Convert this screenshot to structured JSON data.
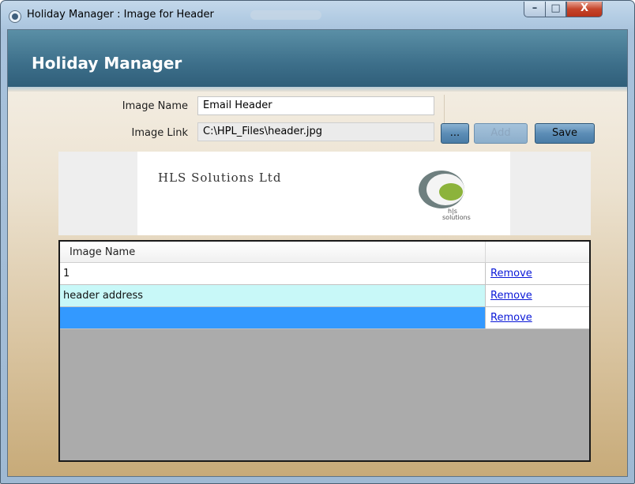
{
  "window": {
    "title": "Holiday Manager : Image for Header",
    "minimize_glyph": "–",
    "maximize_glyph": "□",
    "close_glyph": "X"
  },
  "banner": {
    "title": "Holiday Manager"
  },
  "form": {
    "image_name_label": "Image Name",
    "image_name_value": "Email Header",
    "image_link_label": "Image Link",
    "image_link_value": "C:\\HPL_Files\\header.jpg",
    "browse_label": "...",
    "add_label": "Add",
    "save_label": "Save"
  },
  "preview": {
    "company_name": "HLS Solutions Ltd",
    "logo_text_top": "h|s",
    "logo_text_bottom": "solutions"
  },
  "grid": {
    "header": "Image Name",
    "rows": [
      {
        "name": "1",
        "action": "Remove",
        "background": "#ffffff"
      },
      {
        "name": "header address",
        "action": "Remove",
        "background": "#c8f8f8"
      },
      {
        "name": "",
        "action": "Remove",
        "background": "#3399ff"
      }
    ],
    "empty_area_color": "#ababab"
  },
  "colors": {
    "banner": "#3d6f8a",
    "button": "#5c8db6",
    "link": "#0a18d8",
    "selected_row": "#3399ff",
    "alt_row": "#c8f8f8"
  }
}
